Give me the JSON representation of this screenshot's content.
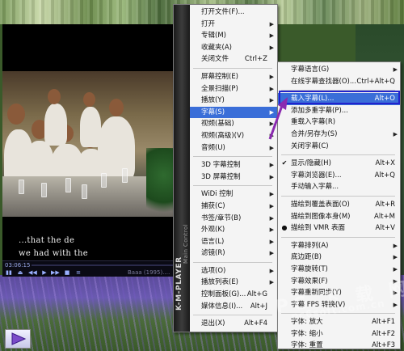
{
  "player": {
    "time": "03:06:15",
    "file_title": "Baaa (1995).…",
    "subtitle_line1": "...that the de",
    "subtitle_line2": "we had with the",
    "menu_brand": "K-M-PLAYER",
    "menu_brand_sub": "Main Control"
  },
  "main_menu": {
    "items": [
      {
        "label": "打开文件(F)...",
        "shortcut": "",
        "arrow": false
      },
      {
        "label": "打开",
        "shortcut": "",
        "arrow": true
      },
      {
        "label": "专辑(M)",
        "shortcut": "",
        "arrow": true
      },
      {
        "label": "收藏夹(A)",
        "shortcut": "",
        "arrow": true
      },
      {
        "label": "关闭文件",
        "shortcut": "Ctrl+Z",
        "arrow": false
      },
      {
        "sep": true
      },
      {
        "label": "屏幕控制(E)",
        "shortcut": "",
        "arrow": true
      },
      {
        "label": "全景扫描(P)",
        "shortcut": "",
        "arrow": true
      },
      {
        "label": "播放(Y)",
        "shortcut": "",
        "arrow": true
      },
      {
        "label": "字幕(S)",
        "shortcut": "",
        "arrow": true,
        "highlight": true
      },
      {
        "label": "视频(基础)",
        "shortcut": "",
        "arrow": true
      },
      {
        "label": "视频(高级)(V)",
        "shortcut": "",
        "arrow": true
      },
      {
        "label": "音频(U)",
        "shortcut": "",
        "arrow": true
      },
      {
        "sep": true
      },
      {
        "label": "3D 字幕控制",
        "shortcut": "",
        "arrow": true
      },
      {
        "label": "3D 屏幕控制",
        "shortcut": "",
        "arrow": true
      },
      {
        "sep": true
      },
      {
        "label": "WiDi 控制",
        "shortcut": "",
        "arrow": true
      },
      {
        "label": "捕获(C)",
        "shortcut": "",
        "arrow": true
      },
      {
        "label": "书签/章节(B)",
        "shortcut": "",
        "arrow": true
      },
      {
        "label": "外观(K)",
        "shortcut": "",
        "arrow": true
      },
      {
        "label": "语言(L)",
        "shortcut": "",
        "arrow": true
      },
      {
        "label": "滤镜(R)",
        "shortcut": "",
        "arrow": true
      },
      {
        "sep": true
      },
      {
        "label": "选项(O)",
        "shortcut": "",
        "arrow": true
      },
      {
        "label": "播放列表(E)",
        "shortcut": "",
        "arrow": true
      },
      {
        "label": "控制面板(G)...",
        "shortcut": "Alt+G",
        "arrow": false
      },
      {
        "label": "媒体信息(I)...",
        "shortcut": "Alt+J",
        "arrow": false
      },
      {
        "sep": true
      },
      {
        "label": "退出(X)",
        "shortcut": "Alt+F4",
        "arrow": false
      }
    ]
  },
  "sub_menu": {
    "items": [
      {
        "label": "字幕语言(G)",
        "shortcut": "",
        "arrow": true
      },
      {
        "label": "在线字幕查找器(O)...",
        "shortcut": "Ctrl+Alt+Q",
        "arrow": false
      },
      {
        "sep": true
      },
      {
        "label": "载入字幕(L)...",
        "shortcut": "Alt+O",
        "arrow": false,
        "highlight": true
      },
      {
        "label": "添加多重字幕(P)...",
        "shortcut": "",
        "arrow": false
      },
      {
        "label": "重载入字幕(R)",
        "shortcut": "",
        "arrow": false
      },
      {
        "label": "合并/另存为(S)",
        "shortcut": "",
        "arrow": true
      },
      {
        "label": "关闭字幕(C)",
        "shortcut": "",
        "arrow": false
      },
      {
        "sep": true
      },
      {
        "label": "显示/隐藏(H)",
        "shortcut": "Alt+X",
        "arrow": false,
        "mark": "✔"
      },
      {
        "label": "字幕浏览器(E)...",
        "shortcut": "Alt+Q",
        "arrow": false
      },
      {
        "label": "手动输入字幕...",
        "shortcut": "",
        "arrow": false
      },
      {
        "sep": true
      },
      {
        "label": "描绘到覆盖表面(O)",
        "shortcut": "Alt+R",
        "arrow": false
      },
      {
        "label": "描绘到图像本身(M)",
        "shortcut": "Alt+M",
        "arrow": false
      },
      {
        "label": "描绘到 VMR 表面",
        "shortcut": "Alt+V",
        "arrow": false,
        "mark": "●"
      },
      {
        "sep": true
      },
      {
        "label": "字幕排列(A)",
        "shortcut": "",
        "arrow": true
      },
      {
        "label": "底边距(B)",
        "shortcut": "",
        "arrow": true
      },
      {
        "label": "字幕旋转(T)",
        "shortcut": "",
        "arrow": true
      },
      {
        "label": "字幕效果(F)",
        "shortcut": "",
        "arrow": true
      },
      {
        "label": "字幕重新同步(Y)",
        "shortcut": "",
        "arrow": true
      },
      {
        "label": "字幕 FPS 转换(V)",
        "shortcut": "",
        "arrow": true
      },
      {
        "sep": true
      },
      {
        "label": "字体: 放大",
        "shortcut": "Alt+F1",
        "arrow": false
      },
      {
        "label": "字体: 缩小",
        "shortcut": "Alt+F2",
        "arrow": false
      },
      {
        "label": "字体: 重置",
        "shortcut": "Alt+F3",
        "arrow": false
      }
    ]
  },
  "watermark": {
    "line1": "PC 下 载 网",
    "line2": "pc6soft.com.cn"
  }
}
